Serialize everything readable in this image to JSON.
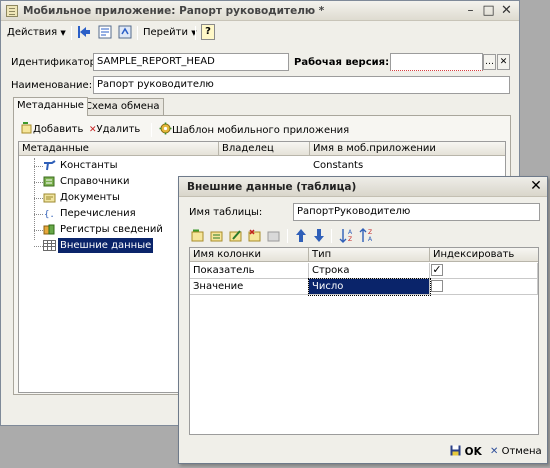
{
  "main_window": {
    "title": "Мобильное приложение: Рапорт руководителю *",
    "toolbar": {
      "actions_label": "Действия",
      "goto_label": "Перейти",
      "help_label": "?"
    },
    "fields": {
      "id_label": "Идентификатор:",
      "id_value": "SAMPLE_REPORT_HEAD",
      "working_version_label": "Рабочая версия:",
      "working_version_value": "",
      "name_label": "Наименование:",
      "name_value": "Рапорт руководителю"
    },
    "tabs": [
      "Метаданные",
      "Схема обмена"
    ],
    "metadata_toolbar": {
      "add_label": "Добавить",
      "delete_label": "Удалить",
      "template_label": "Шаблон мобильного приложения"
    },
    "metadata_grid": {
      "headers": [
        "Метаданные",
        "Владелец",
        "Имя в моб.приложении"
      ],
      "rows": [
        {
          "name": "Константы",
          "owner": "",
          "mobile_name": "Constants",
          "icon": "constants-icon"
        },
        {
          "name": "Справочники",
          "owner": "",
          "mobile_name": "",
          "icon": "catalogs-icon"
        },
        {
          "name": "Документы",
          "owner": "",
          "mobile_name": "",
          "icon": "documents-icon"
        },
        {
          "name": "Перечисления",
          "owner": "",
          "mobile_name": "",
          "icon": "enums-icon"
        },
        {
          "name": "Регистры сведений",
          "owner": "",
          "mobile_name": "",
          "icon": "registers-icon"
        },
        {
          "name": "Внешние данные",
          "owner": "",
          "mobile_name": "",
          "icon": "external-data-icon",
          "selected": true
        }
      ]
    }
  },
  "dialog": {
    "title": "Внешние данные (таблица)",
    "table_name_label": "Имя таблицы:",
    "table_name_value": "РапортРуководителю",
    "grid": {
      "headers": [
        "Имя колонки",
        "Тип",
        "Индексировать"
      ],
      "rows": [
        {
          "name": "Показатель",
          "type": "Строка",
          "indexed": true
        },
        {
          "name": "Значение",
          "type": "Число",
          "indexed": false,
          "type_selected": true
        }
      ]
    },
    "ok_label": "OK",
    "cancel_label": "Отмена"
  },
  "colors": {
    "selection": "#0a246a",
    "window_bg": "#f0efe9",
    "desktop_bg": "#ababab"
  }
}
